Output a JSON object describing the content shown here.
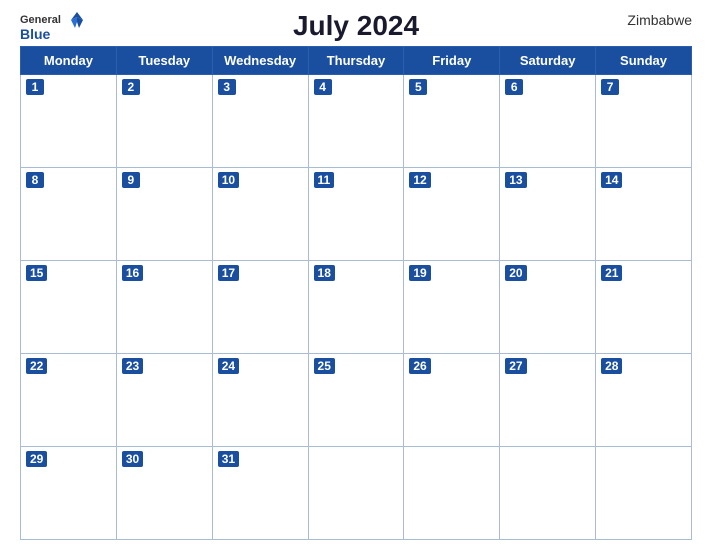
{
  "header": {
    "title": "July 2024",
    "country": "Zimbabwe",
    "logo_general": "General",
    "logo_blue": "Blue"
  },
  "weekdays": [
    "Monday",
    "Tuesday",
    "Wednesday",
    "Thursday",
    "Friday",
    "Saturday",
    "Sunday"
  ],
  "weeks": [
    [
      1,
      2,
      3,
      4,
      5,
      6,
      7
    ],
    [
      8,
      9,
      10,
      11,
      12,
      13,
      14
    ],
    [
      15,
      16,
      17,
      18,
      19,
      20,
      21
    ],
    [
      22,
      23,
      24,
      25,
      26,
      27,
      28
    ],
    [
      29,
      30,
      31,
      null,
      null,
      null,
      null
    ]
  ]
}
